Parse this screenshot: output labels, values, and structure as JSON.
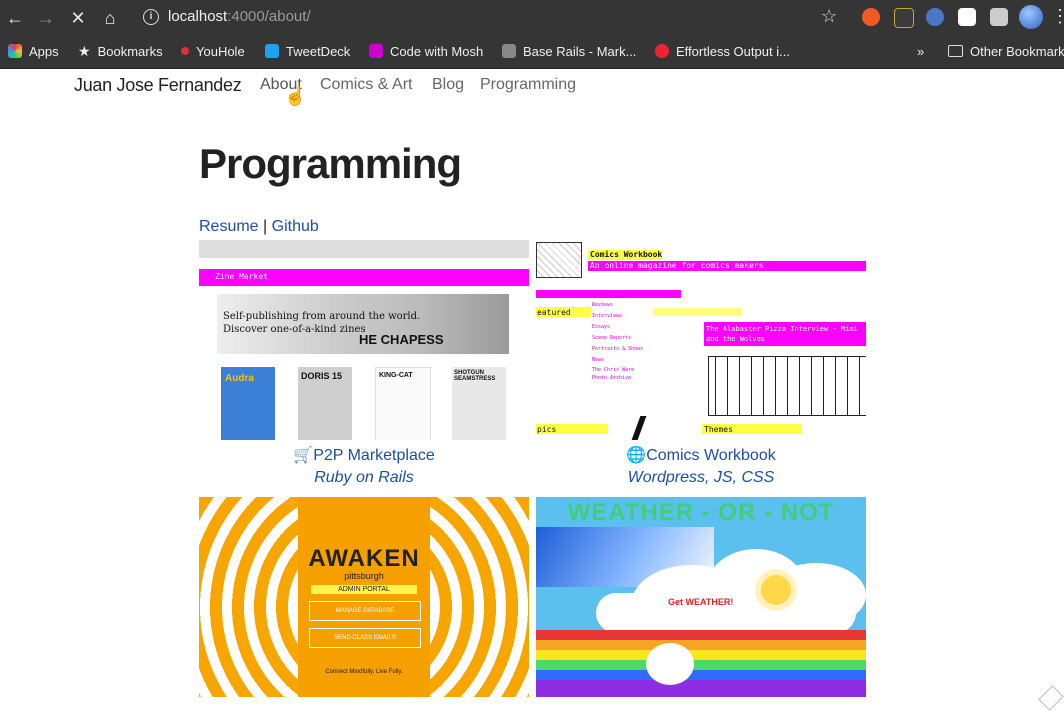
{
  "browser": {
    "url_host": "localhost",
    "url_path": ":4000/about/",
    "bookmarks": [
      {
        "label": "Apps",
        "color": "#e34"
      },
      {
        "label": "Bookmarks",
        "color": "#fff"
      },
      {
        "label": "YouHole",
        "color": "#d33"
      },
      {
        "label": "TweetDeck",
        "color": "#1da1f2"
      },
      {
        "label": "Code with Mosh",
        "color": "#c0c"
      },
      {
        "label": "Base Rails - Mark...",
        "color": "#888"
      },
      {
        "label": "Effortless Output i...",
        "color": "#e23"
      }
    ],
    "overflow": "»",
    "other_bookmarks": "Other Bookmarks"
  },
  "site": {
    "brand": "Juan Jose Fernandez",
    "nav": [
      "About",
      "Comics & Art",
      "Blog",
      "Programming"
    ]
  },
  "page": {
    "title": "Programming",
    "resume_label": "Resume",
    "separator": "|",
    "github_label": "Github"
  },
  "projects": [
    {
      "icon": "🛒",
      "title": "P2P Marketplace",
      "tech": "Ruby on Rails",
      "thumb": {
        "header": "Zine Market",
        "hero_line1": "Self-publishing from around the world.",
        "hero_line2": "Discover one-of-a-kind zines",
        "hero_word": "HE CHAPESS",
        "zines": [
          "Audra",
          "DORIS 15",
          "KING-CAT",
          "SHOTGUN SEAMSTRESS"
        ]
      }
    },
    {
      "icon": "🌐",
      "title": "Comics Workbook",
      "tech": "Wordpress, JS, CSS",
      "thumb": {
        "header": "Comics Workbook",
        "tagline": "An online magazine for comics makers",
        "featured": "eatured",
        "menu": [
          "Reviews",
          "Interviews",
          "Essays",
          "Scene Reports",
          "Portraits & Shows",
          "News",
          "The Chris Ware Photo Archive"
        ],
        "article": "The Alabaster Pizza Interview - Mimi and the Wolves",
        "footer_left": "pics",
        "footer_right": "Themes"
      }
    },
    {
      "icon": "",
      "title": "",
      "tech": "",
      "thumb": {
        "title": "AWAKEN",
        "subtitle": "pittsburgh",
        "bar": "ADMIN PORTAL",
        "btn1": "MANAGE DATABASE",
        "btn2": "SEND CLASS EMAILS",
        "footer": "Connect Mindfully. Live Fully."
      }
    },
    {
      "icon": "",
      "title": "",
      "tech": "",
      "thumb": {
        "title": "WEATHER - OR - NOT",
        "button": "Get WEATHER!"
      }
    }
  ]
}
